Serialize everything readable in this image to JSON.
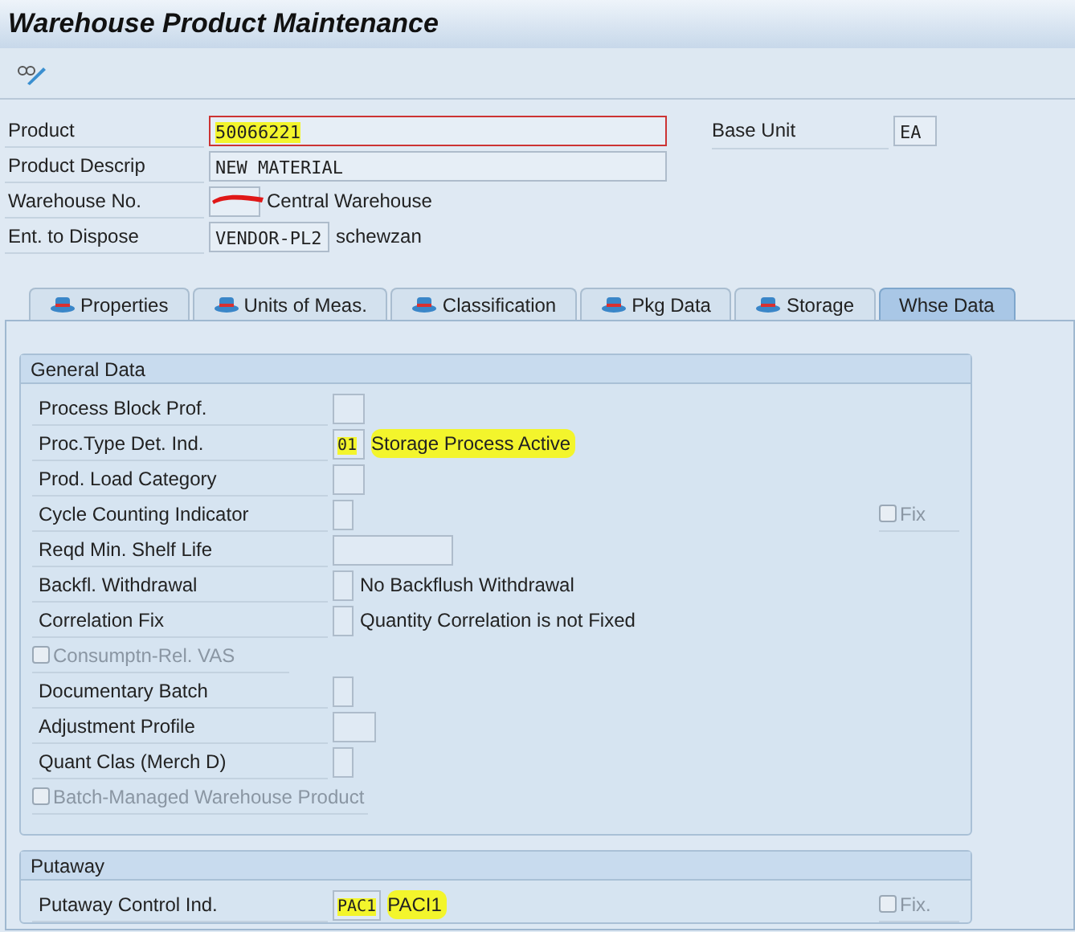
{
  "window": {
    "title": "Warehouse Product Maintenance"
  },
  "header_fields": [
    {
      "label": "Product",
      "value": "50066221",
      "required": true,
      "highlighted": true
    },
    {
      "label": "Product Descrip",
      "value": "NEW MATERIAL",
      "required": false
    },
    {
      "label": "Warehouse No.",
      "redacted": true,
      "description": "Central Warehouse",
      "required": false
    },
    {
      "label": "Ent. to Dispose",
      "value": "VENDOR-PL2",
      "description": "schewzan",
      "required": false
    }
  ],
  "base_unit": {
    "label": "Base Unit",
    "value": "EA"
  },
  "tabs": [
    {
      "label": "Properties",
      "selected": false
    },
    {
      "label": "Units of Meas.",
      "selected": false
    },
    {
      "label": "Classification",
      "selected": false
    },
    {
      "label": "Pkg Data",
      "selected": false
    },
    {
      "label": "Storage",
      "selected": false
    },
    {
      "label": "Whse Data",
      "selected": true
    }
  ],
  "general_data": {
    "title": "General Data",
    "rows": [
      {
        "kind": "field",
        "label": "Process Block Prof."
      },
      {
        "kind": "field",
        "label": "Proc.Type Det. Ind.",
        "value": "01",
        "description": "Storage Process Active",
        "highlighted": true
      },
      {
        "kind": "field",
        "label": "Prod. Load Category"
      },
      {
        "kind": "field",
        "label": "Cycle Counting Indicator",
        "fix": {
          "label": "Fix",
          "checked": false
        }
      },
      {
        "kind": "field",
        "label": "Reqd Min. Shelf Life"
      },
      {
        "kind": "field",
        "label": "Backfl. Withdrawal",
        "description": "No Backflush Withdrawal"
      },
      {
        "kind": "field",
        "label": "Correlation Fix",
        "description": "Quantity Correlation is not Fixed"
      },
      {
        "kind": "checkbox",
        "label": "Consumptn-Rel. VAS",
        "checked": false
      },
      {
        "kind": "field",
        "label": "Documentary Batch"
      },
      {
        "kind": "field",
        "label": "Adjustment Profile"
      },
      {
        "kind": "field",
        "label": "Quant Clas (Merch D)"
      },
      {
        "kind": "checkbox",
        "label": "Batch-Managed Warehouse Product",
        "checked": false
      }
    ]
  },
  "putaway": {
    "title": "Putaway",
    "rows": [
      {
        "kind": "field",
        "label": "Putaway Control Ind.",
        "value": "PAC1",
        "description": "PACI1",
        "highlighted": true,
        "fix": {
          "label": "Fix.",
          "checked": false
        }
      }
    ]
  }
}
